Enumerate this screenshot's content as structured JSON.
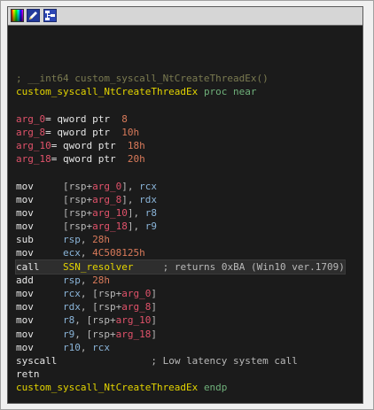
{
  "toolbar": {
    "buttons": [
      {
        "icon": "color-palette-icon"
      },
      {
        "icon": "edit-icon"
      },
      {
        "icon": "graph-view-icon"
      }
    ]
  },
  "disassembly": {
    "prototype_comment": "; __int64 custom_syscall_NtCreateThreadEx()",
    "proc_name": "custom_syscall_NtCreateThreadEx",
    "proc_kw": "proc near",
    "args": [
      {
        "name": "arg_0",
        "eq": "= qword ptr  ",
        "val": "8"
      },
      {
        "name": "arg_8",
        "eq": "= qword ptr  ",
        "val": "10h"
      },
      {
        "name": "arg_10",
        "eq": "= qword ptr  ",
        "val": "18h"
      },
      {
        "name": "arg_18",
        "eq": "= qword ptr  ",
        "val": "20h"
      }
    ],
    "instructions": {
      "i1": {
        "mn": "mov",
        "p1": "[rsp+",
        "a": "arg_0",
        "p2": "], ",
        "r": "rcx"
      },
      "i2": {
        "mn": "mov",
        "p1": "[rsp+",
        "a": "arg_8",
        "p2": "], ",
        "r": "rdx"
      },
      "i3": {
        "mn": "mov",
        "p1": "[rsp+",
        "a": "arg_10",
        "p2": "], ",
        "r": "r8"
      },
      "i4": {
        "mn": "mov",
        "p1": "[rsp+",
        "a": "arg_18",
        "p2": "], ",
        "r": "r9"
      },
      "i5": {
        "mn": "sub",
        "r": "rsp",
        "sep": ", ",
        "n": "28h"
      },
      "i6": {
        "mn": "mov",
        "r": "ecx",
        "sep": ", ",
        "n": "4C508125h"
      },
      "i7": {
        "mn": "call",
        "target": "SSN_resolver",
        "comment": "; returns 0xBA (Win10 ver.1709)"
      },
      "i8": {
        "mn": "add",
        "r": "rsp",
        "sep": ", ",
        "n": "28h"
      },
      "i9": {
        "mn": "mov",
        "r": "rcx",
        "sep": ", ",
        "p1": "[rsp+",
        "a": "arg_0",
        "p2": "]"
      },
      "i10": {
        "mn": "mov",
        "r": "rdx",
        "sep": ", ",
        "p1": "[rsp+",
        "a": "arg_8",
        "p2": "]"
      },
      "i11": {
        "mn": "mov",
        "r": "r8",
        "sep": ", ",
        "p1": "[rsp+",
        "a": "arg_10",
        "p2": "]"
      },
      "i12": {
        "mn": "mov",
        "r": "r9",
        "sep": ", ",
        "p1": "[rsp+",
        "a": "arg_18",
        "p2": "]"
      },
      "i13": {
        "mn": "mov",
        "r": "r10",
        "sep": ", ",
        "r2": "rcx"
      },
      "i14": {
        "mn": "syscall",
        "comment": "; Low latency system call"
      },
      "i15": {
        "mn": "retn"
      }
    },
    "endp_name": "custom_syscall_NtCreateThreadEx",
    "endp_kw": "endp"
  },
  "colors": {
    "background": "#1b1b1b",
    "comment": "#7a7a50",
    "name": "#e3d400",
    "arg": "#e0526a",
    "number": "#d97a5a",
    "register": "#8ab4d8",
    "mnemonic": "#e6e6e6"
  }
}
